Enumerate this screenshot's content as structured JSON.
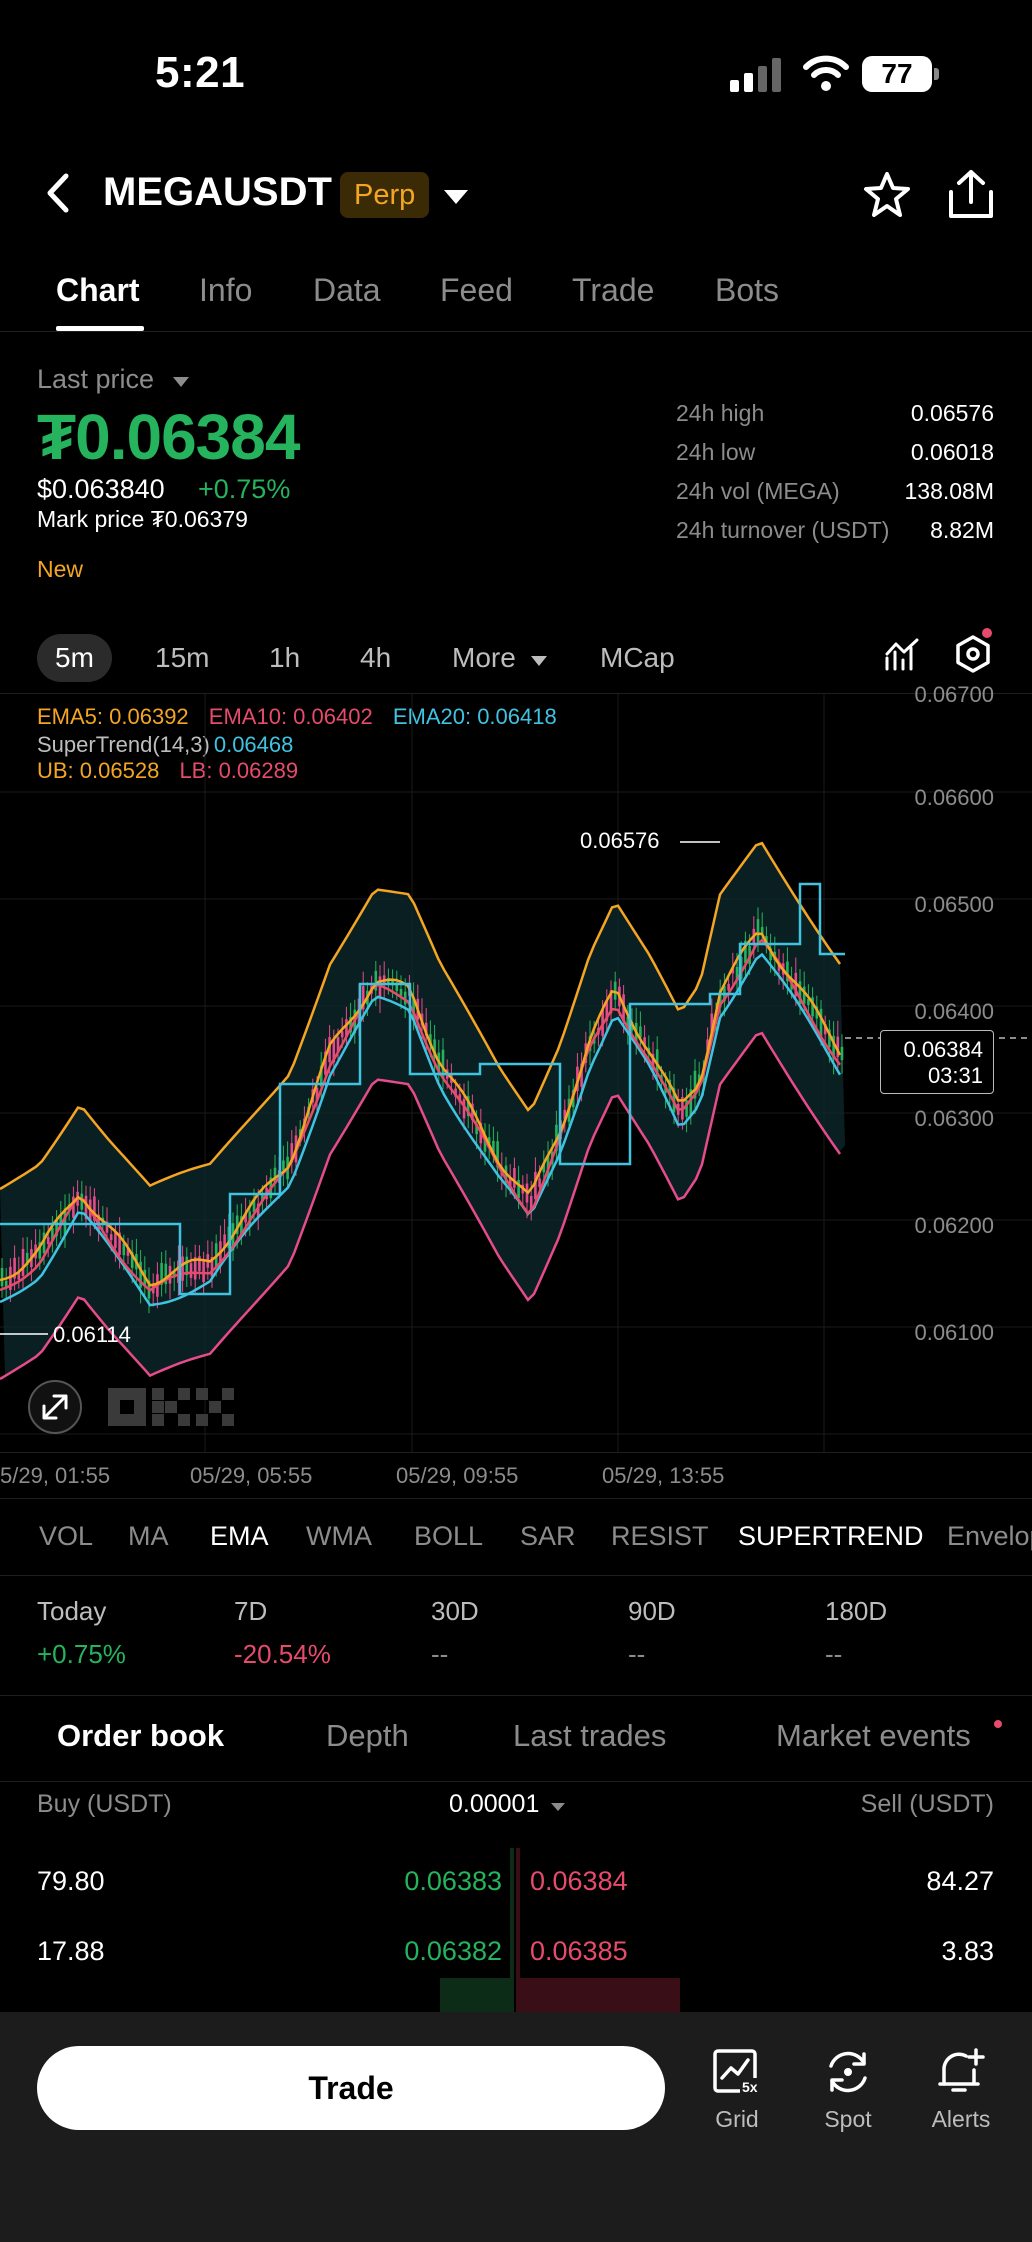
{
  "status_bar": {
    "time": "5:21",
    "battery": "77"
  },
  "header": {
    "pair": "MEGAUSDT",
    "badge": "Perp"
  },
  "tabs": [
    "Chart",
    "Info",
    "Data",
    "Feed",
    "Trade",
    "Bots"
  ],
  "price": {
    "label": "Last price",
    "big": "₮0.06384",
    "usd": "$0.063840",
    "change": "+0.75%",
    "mark": "Mark price ₮0.06379",
    "new_tag": "New"
  },
  "stats": [
    {
      "label": "24h high",
      "value": "0.06576"
    },
    {
      "label": "24h low",
      "value": "0.06018"
    },
    {
      "label": "24h vol (MEGA)",
      "value": "138.08M"
    },
    {
      "label": "24h turnover (USDT)",
      "value": "8.82M"
    }
  ],
  "intervals": [
    "5m",
    "15m",
    "1h",
    "4h",
    "More",
    "MCap"
  ],
  "legend": {
    "ema5": "EMA5: 0.06392",
    "ema10": "EMA10: 0.06402",
    "ema20": "EMA20: 0.06418",
    "supertrend": "SuperTrend(14,3)",
    "supertrend_val": "0.06468",
    "ub": "UB: 0.06528",
    "lb": "LB: 0.06289"
  },
  "chart": {
    "price_axis": [
      "0.06700",
      "0.06600",
      "0.06500",
      "0.06400",
      "0.06300",
      "0.06200",
      "0.06100"
    ],
    "current_price": "0.06384",
    "countdown": "03:31",
    "high_mark": "0.06576",
    "low_mark": "0.06114",
    "dates": [
      "5/29, 01:55",
      "05/29, 05:55",
      "05/29, 09:55",
      "05/29, 13:55"
    ],
    "colors": {
      "ema5": "#f4a623",
      "ema10": "#e64b6b",
      "ema20": "#3fc3e0",
      "up": "#25b35d",
      "down": "#e64b8b"
    }
  },
  "indicators": [
    "VOL",
    "MA",
    "EMA",
    "WMA",
    "BOLL",
    "SAR",
    "RESIST",
    "SUPERTREND",
    "Envelop"
  ],
  "performance": [
    {
      "label": "Today",
      "value": "+0.75%"
    },
    {
      "label": "7D",
      "value": "-20.54%"
    },
    {
      "label": "30D",
      "value": "--"
    },
    {
      "label": "90D",
      "value": "--"
    },
    {
      "label": "180D",
      "value": "--"
    }
  ],
  "orderbook": {
    "tabs": [
      "Order book",
      "Depth",
      "Last trades",
      "Market events"
    ],
    "buy_header": "Buy (USDT)",
    "precision": "0.00001",
    "sell_header": "Sell (USDT)",
    "rows": [
      {
        "buy_qty": "79.80",
        "bid": "0.06383",
        "ask": "0.06384",
        "sell_qty": "84.27"
      },
      {
        "buy_qty": "17.88",
        "bid": "0.06382",
        "ask": "0.06385",
        "sell_qty": "3.83"
      }
    ]
  },
  "bottom": {
    "trade": "Trade",
    "grid": "Grid",
    "spot": "Spot",
    "alerts": "Alerts",
    "grid_badge": "5x"
  }
}
